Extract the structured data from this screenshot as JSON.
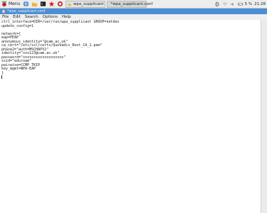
{
  "taskbar": {
    "menu_label": "Menu",
    "tasks": [
      {
        "label": "wpa_supplicant"
      },
      {
        "label": "*wpa_supplicant.conf"
      }
    ],
    "tray": {
      "battery_text": "5 %",
      "clock": "21:28"
    }
  },
  "window": {
    "title": "*wpa_supplicant.conf"
  },
  "menubar": {
    "items": [
      "File",
      "Edit",
      "Search",
      "Options",
      "Help"
    ]
  },
  "editor": {
    "lines": [
      "ctrl_interface=DIR=/var/run/wpa_supplicant GROUP=netdev",
      "update_config=1",
      "",
      "network={",
      "eap=PEAP",
      "anonymous_identity=\"@cam.ac.uk\"",
      "ca_cert=\"/etc/ssl/certs/QuoVadis_Root_CA_2.pem\"",
      "phase2=\"auth=MSCHAPV2\"",
      "identity=\"xxx123@cam.ac.uk\"",
      "password=\"xxxxxxxxxxxxxxxxxxx\"",
      "ssid=\"eduroam\"",
      "pairwise=CCMP TKIP",
      "key_mgmt=WPA-EAP",
      "}"
    ]
  },
  "colors": {
    "titlebar": "#4a8fd4",
    "taskbar": "#ededed"
  }
}
